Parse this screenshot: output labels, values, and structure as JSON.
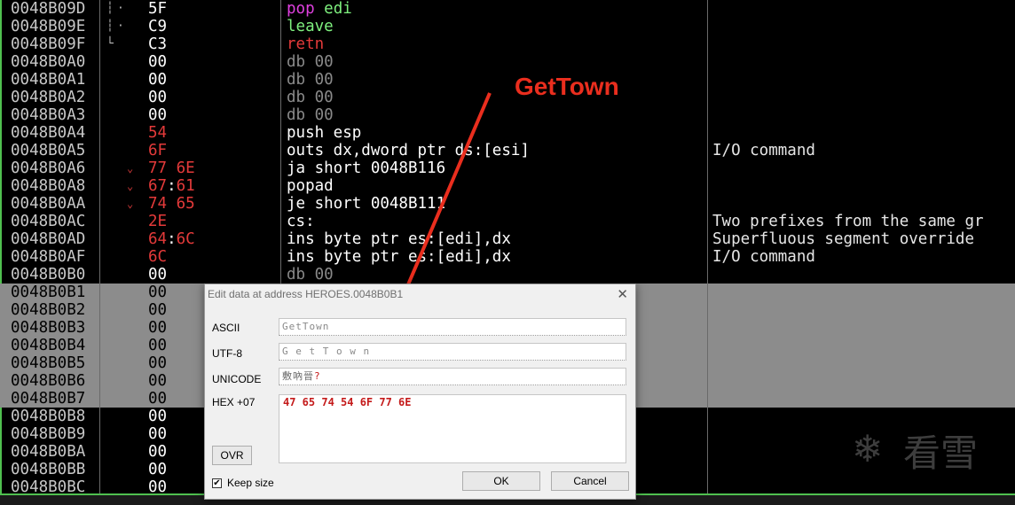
{
  "disasm_rows": [
    {
      "addr": "0048B09D",
      "tree": "·",
      "bytes": [
        {
          "t": "5F",
          "c": "#ffffff"
        }
      ],
      "asm": [
        {
          "t": "pop ",
          "c": "#e040e0"
        },
        {
          "t": "edi",
          "c": "#7ef07e"
        }
      ],
      "comment": ""
    },
    {
      "addr": "0048B09E",
      "tree": "·",
      "bytes": [
        {
          "t": "C9",
          "c": "#ffffff"
        }
      ],
      "asm": [
        {
          "t": "leave",
          "c": "#7ef07e"
        }
      ],
      "comment": ""
    },
    {
      "addr": "0048B09F",
      "tree": "└",
      "bytes": [
        {
          "t": "C3",
          "c": "#ffffff"
        }
      ],
      "asm": [
        {
          "t": "retn",
          "c": "#e43a3a"
        }
      ],
      "comment": ""
    },
    {
      "addr": "0048B0A0",
      "tree": "",
      "bytes": [
        {
          "t": "00",
          "c": "#ffffff"
        }
      ],
      "asm": [
        {
          "t": "db 00",
          "c": "#8a8a8a"
        }
      ],
      "comment": ""
    },
    {
      "addr": "0048B0A1",
      "tree": "",
      "bytes": [
        {
          "t": "00",
          "c": "#ffffff"
        }
      ],
      "asm": [
        {
          "t": "db 00",
          "c": "#8a8a8a"
        }
      ],
      "comment": ""
    },
    {
      "addr": "0048B0A2",
      "tree": "",
      "bytes": [
        {
          "t": "00",
          "c": "#ffffff"
        }
      ],
      "asm": [
        {
          "t": "db 00",
          "c": "#8a8a8a"
        }
      ],
      "comment": ""
    },
    {
      "addr": "0048B0A3",
      "tree": "",
      "bytes": [
        {
          "t": "00",
          "c": "#ffffff"
        }
      ],
      "asm": [
        {
          "t": "db 00",
          "c": "#8a8a8a"
        }
      ],
      "comment": ""
    },
    {
      "addr": "0048B0A4",
      "tree": "",
      "bytes": [
        {
          "t": "54",
          "c": "#e43a3a"
        }
      ],
      "asm": [
        {
          "t": "push esp",
          "c": "#ffffff"
        }
      ],
      "comment": ""
    },
    {
      "addr": "0048B0A5",
      "tree": "",
      "bytes": [
        {
          "t": "6F",
          "c": "#e43a3a"
        }
      ],
      "asm": [
        {
          "t": "outs dx,dword ptr ds:[esi]",
          "c": "#ffffff"
        }
      ],
      "comment": "I/O command"
    },
    {
      "addr": "0048B0A6",
      "tree": "v",
      "bytes": [
        {
          "t": "77 6E",
          "c": "#e43a3a"
        }
      ],
      "asm": [
        {
          "t": "ja short 0048B116",
          "c": "#ffffff"
        }
      ],
      "comment": ""
    },
    {
      "addr": "0048B0A8",
      "tree": "v",
      "bytes": [
        {
          "t": "67",
          "c": "#e43a3a"
        },
        {
          "t": ":",
          "c": "#ffffff"
        },
        {
          "t": "61",
          "c": "#e43a3a"
        }
      ],
      "asm": [
        {
          "t": "popad",
          "c": "#ffffff"
        }
      ],
      "comment": ""
    },
    {
      "addr": "0048B0AA",
      "tree": "v",
      "bytes": [
        {
          "t": "74 65",
          "c": "#e43a3a"
        }
      ],
      "asm": [
        {
          "t": "je short 0048B111",
          "c": "#ffffff"
        }
      ],
      "comment": ""
    },
    {
      "addr": "0048B0AC",
      "tree": "",
      "bytes": [
        {
          "t": "2E",
          "c": "#e43a3a"
        }
      ],
      "asm": [
        {
          "t": "cs:",
          "c": "#ffffff"
        }
      ],
      "comment": "Two prefixes from the same gr"
    },
    {
      "addr": "0048B0AD",
      "tree": "",
      "bytes": [
        {
          "t": "64",
          "c": "#e43a3a"
        },
        {
          "t": ":",
          "c": "#ffffff"
        },
        {
          "t": "6C",
          "c": "#e43a3a"
        }
      ],
      "asm": [
        {
          "t": "ins byte ptr es:[edi],dx",
          "c": "#ffffff"
        }
      ],
      "comment": "Superfluous segment override"
    },
    {
      "addr": "0048B0AF",
      "tree": "",
      "bytes": [
        {
          "t": "6C",
          "c": "#e43a3a"
        }
      ],
      "asm": [
        {
          "t": "ins byte ptr es:[edi],dx",
          "c": "#ffffff"
        }
      ],
      "comment": "I/O command"
    },
    {
      "addr": "0048B0B0",
      "tree": "",
      "bytes": [
        {
          "t": "00",
          "c": "#ffffff"
        }
      ],
      "asm": [
        {
          "t": "db 00",
          "c": "#8a8a8a"
        }
      ],
      "comment": ""
    },
    {
      "addr": "0048B0B1",
      "tree": "",
      "sel": true,
      "bytes": [
        {
          "t": "00",
          "c": "#000000"
        }
      ],
      "asm": [],
      "comment": ""
    },
    {
      "addr": "0048B0B2",
      "tree": "",
      "sel": true,
      "bytes": [
        {
          "t": "00",
          "c": "#000000"
        }
      ],
      "asm": [],
      "comment": ""
    },
    {
      "addr": "0048B0B3",
      "tree": "",
      "sel": true,
      "bytes": [
        {
          "t": "00",
          "c": "#000000"
        }
      ],
      "asm": [],
      "comment": ""
    },
    {
      "addr": "0048B0B4",
      "tree": "",
      "sel": true,
      "bytes": [
        {
          "t": "00",
          "c": "#000000"
        }
      ],
      "asm": [],
      "comment": ""
    },
    {
      "addr": "0048B0B5",
      "tree": "",
      "sel": true,
      "bytes": [
        {
          "t": "00",
          "c": "#000000"
        }
      ],
      "asm": [],
      "comment": ""
    },
    {
      "addr": "0048B0B6",
      "tree": "",
      "sel": true,
      "bytes": [
        {
          "t": "00",
          "c": "#000000"
        }
      ],
      "asm": [],
      "comment": ""
    },
    {
      "addr": "0048B0B7",
      "tree": "",
      "sel": true,
      "bytes": [
        {
          "t": "00",
          "c": "#000000"
        }
      ],
      "asm": [],
      "comment": ""
    },
    {
      "addr": "0048B0B8",
      "tree": "",
      "bytes": [
        {
          "t": "00",
          "c": "#ffffff"
        }
      ],
      "asm": [],
      "comment": ""
    },
    {
      "addr": "0048B0B9",
      "tree": "",
      "bytes": [
        {
          "t": "00",
          "c": "#ffffff"
        }
      ],
      "asm": [],
      "comment": ""
    },
    {
      "addr": "0048B0BA",
      "tree": "",
      "bytes": [
        {
          "t": "00",
          "c": "#ffffff"
        }
      ],
      "asm": [],
      "comment": ""
    },
    {
      "addr": "0048B0BB",
      "tree": "",
      "bytes": [
        {
          "t": "00",
          "c": "#ffffff"
        }
      ],
      "asm": [],
      "comment": ""
    },
    {
      "addr": "0048B0BC",
      "tree": "",
      "bytes": [
        {
          "t": "00",
          "c": "#ffffff"
        }
      ],
      "asm": [],
      "comment": ""
    }
  ],
  "annotation": {
    "text": "GetTown",
    "color": "#ea2e1e"
  },
  "dialog": {
    "title": "Edit data at address HEROES.0048B0B1",
    "close_glyph": "✕",
    "ascii_label": "ASCII",
    "ascii_value": "GetTown",
    "utf8_label": "UTF-8",
    "utf8_value": "G e t T o w n",
    "unicode_label": "UNICODE",
    "unicode_value": "敷吶晉",
    "unicode_tail": "?",
    "hex_label": "HEX +07",
    "hex_value": "47 65 74 54 6F 77 6E",
    "ovr_button": "OVR",
    "keep_size_label": "Keep size",
    "keep_size_checked": true,
    "ok_button": "OK",
    "cancel_button": "Cancel"
  },
  "watermark": {
    "glyph": "❄",
    "text": "看雪"
  }
}
